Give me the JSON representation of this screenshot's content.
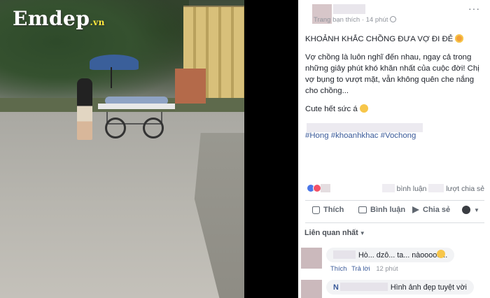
{
  "photo": {
    "logo_main": "Emdep",
    "logo_tld": ".vn"
  },
  "post": {
    "meta_text": "Trang bạn thích · 14 phút",
    "more_label": "···",
    "title": "KHOẢNH KHẮC CHỒNG ĐƯA VỢ ĐI ĐẺ",
    "paragraph": "Vợ chồng là luôn nghĩ đến nhau, ngay cả trong những giây phút khó khăn nhất của cuộc đời! Chị vợ bụng to vượt mặt, vẫn không quên che nắng cho chồng...",
    "closing": "Cute hết sức á",
    "hashtags": "#Hong #khoanhkhac #Vochong",
    "comments_count_label": "bình luận",
    "shares_count_label": "lượt chia sẻ"
  },
  "actions": {
    "like": "Thích",
    "comment": "Bình luận",
    "share": "Chia sẻ"
  },
  "comments": {
    "sort_label": "Liên quan nhất",
    "items": [
      {
        "text": "Hò... dzô... ta... nàooooo...",
        "like": "Thích",
        "reply": "Trả lời",
        "time": "12 phút"
      },
      {
        "name_initial": "N",
        "text": "Hình ảnh đẹp tuyệt vời"
      }
    ]
  },
  "colors": {
    "link": "#385898",
    "meta": "#90949c",
    "action": "#606770",
    "bubble": "#f2f3f5"
  }
}
